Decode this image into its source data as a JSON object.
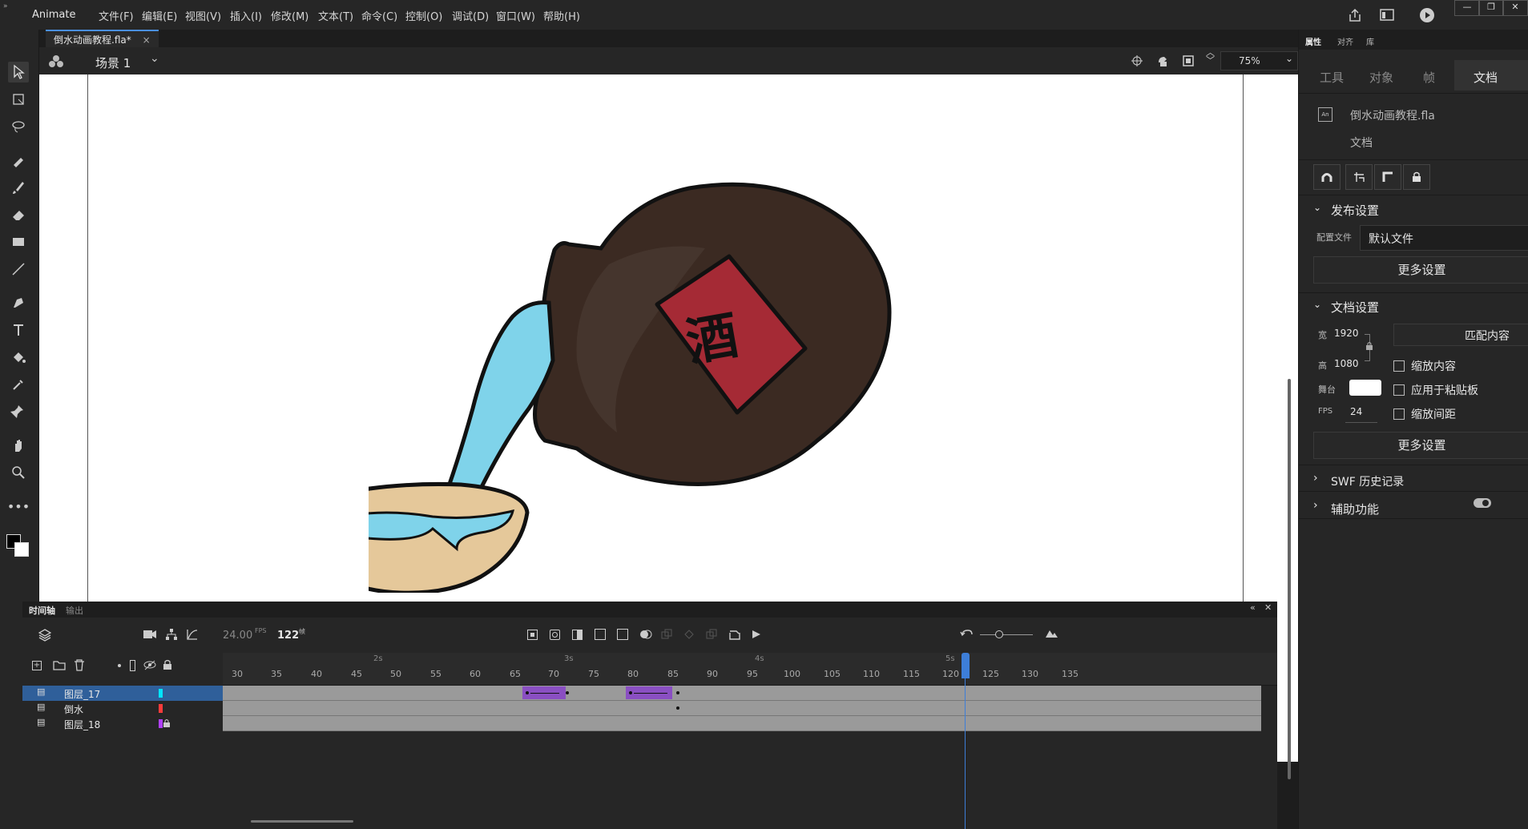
{
  "app": {
    "name": "Animate"
  },
  "menu": [
    "文件(F)",
    "编辑(E)",
    "视图(V)",
    "插入(I)",
    "修改(M)",
    "文本(T)",
    "命令(C)",
    "控制(O)",
    "调试(D)",
    "窗口(W)",
    "帮助(H)"
  ],
  "document_tab": {
    "title": "倒水动画教程.fla*",
    "close": "×"
  },
  "editbar": {
    "scene": "场景 1",
    "zoom": "75%"
  },
  "timeline": {
    "tab_timeline": "时间轴",
    "tab_output": "输出",
    "fps": "24.00",
    "fps_unit": "FPS",
    "frame": "122",
    "frame_unit": "帧",
    "ruler_ticks": [
      "30",
      "35",
      "40",
      "45",
      "50",
      "55",
      "60",
      "65",
      "70",
      "75",
      "80",
      "85",
      "90",
      "95",
      "100",
      "105",
      "110",
      "115",
      "120",
      "125",
      "130",
      "135"
    ],
    "ruler_seconds": [
      "2s",
      "3s",
      "4s",
      "5s"
    ],
    "playhead_frame": 122,
    "layers": [
      {
        "name": "图层_17",
        "color": "#00e5ff",
        "selected": true,
        "locked": false
      },
      {
        "name": "倒水",
        "color": "#ff3b3b",
        "selected": false,
        "locked": false
      },
      {
        "name": "图层_18",
        "color": "#b040ff",
        "selected": false,
        "locked": true
      }
    ]
  },
  "right_panel": {
    "tabs": [
      "属性",
      "对齐",
      "库"
    ],
    "subtabs": [
      "工具",
      "对象",
      "帧",
      "文档"
    ],
    "active_subtab": "文档",
    "doc_name": "倒水动画教程.fla",
    "doc_type": "文档",
    "publish_section": "发布设置",
    "profile_label": "配置文件",
    "profile_value": "默认文件",
    "more_settings": "更多设置",
    "doc_section": "文档设置",
    "width_label": "宽",
    "width_value": "1920",
    "height_label": "高",
    "height_value": "1080",
    "match_content": "匹配内容",
    "scale_content": "缩放内容",
    "stage_label": "舞台",
    "apply_pasteboard": "应用于粘贴板",
    "fps_label": "FPS",
    "fps_value": "24",
    "scale_spacing": "缩放间距",
    "more_settings2": "更多设置",
    "swf_section": "SWF 历史记录",
    "accessibility_section": "辅助功能"
  },
  "stage": {
    "jar_label": "酒",
    "colors": {
      "jar": "#3b2a22",
      "label": "#a52a35",
      "water": "#7fd3ea",
      "bowl": "#e5c89a"
    }
  }
}
